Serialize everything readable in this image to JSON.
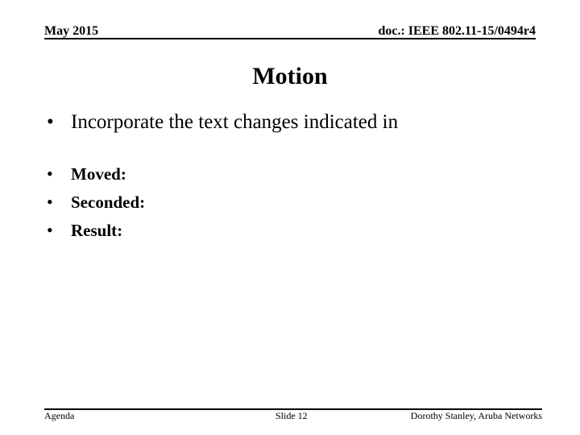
{
  "header": {
    "date": "May 2015",
    "doc_id": "doc.: IEEE 802.11-15/0494r4"
  },
  "slide": {
    "title": "Motion",
    "bullet_glyph": "•",
    "main_bullet": "Incorporate the text changes indicated in",
    "sub_bullets": [
      "Moved:",
      "Seconded:",
      "Result:"
    ]
  },
  "footer": {
    "left": "Agenda",
    "center": "Slide 12",
    "right": "Dorothy Stanley, Aruba Networks"
  }
}
